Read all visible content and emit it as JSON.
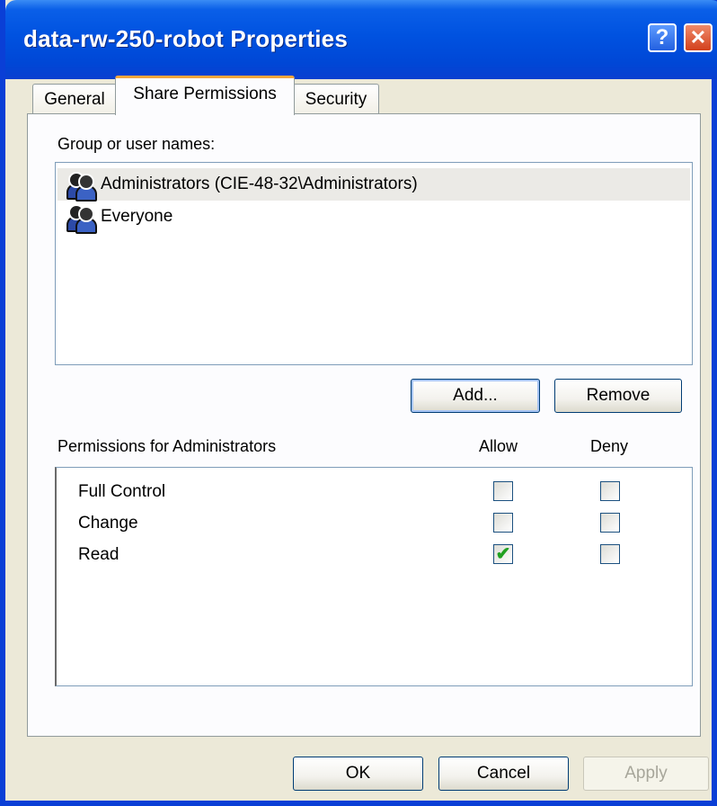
{
  "window": {
    "title": "data-rw-250-robot Properties"
  },
  "titlebar_buttons": {
    "help_glyph": "?",
    "close_glyph": "✕"
  },
  "tabs": [
    {
      "label": "General"
    },
    {
      "label": "Share Permissions",
      "active": true
    },
    {
      "label": "Security"
    }
  ],
  "group_section": {
    "label": "Group or user names:",
    "items": [
      {
        "name": "Administrators (CIE-48-32\\Administrators)",
        "icon": "users-group-icon",
        "selected": true
      },
      {
        "name": "Everyone",
        "icon": "users-group-icon",
        "selected": false
      }
    ]
  },
  "buttons": {
    "add": "Add...",
    "remove": "Remove",
    "ok": "OK",
    "cancel": "Cancel",
    "apply": "Apply"
  },
  "permissions": {
    "label": "Permissions for Administrators",
    "allow_header": "Allow",
    "deny_header": "Deny",
    "rows": [
      {
        "name": "Full Control",
        "allow": false,
        "deny": false
      },
      {
        "name": "Change",
        "allow": false,
        "deny": false
      },
      {
        "name": "Read",
        "allow": true,
        "deny": false
      }
    ]
  },
  "colors": {
    "titlebar": "#0052e0",
    "active_tab_accent": "#f6a63c",
    "check": "#21a121"
  }
}
